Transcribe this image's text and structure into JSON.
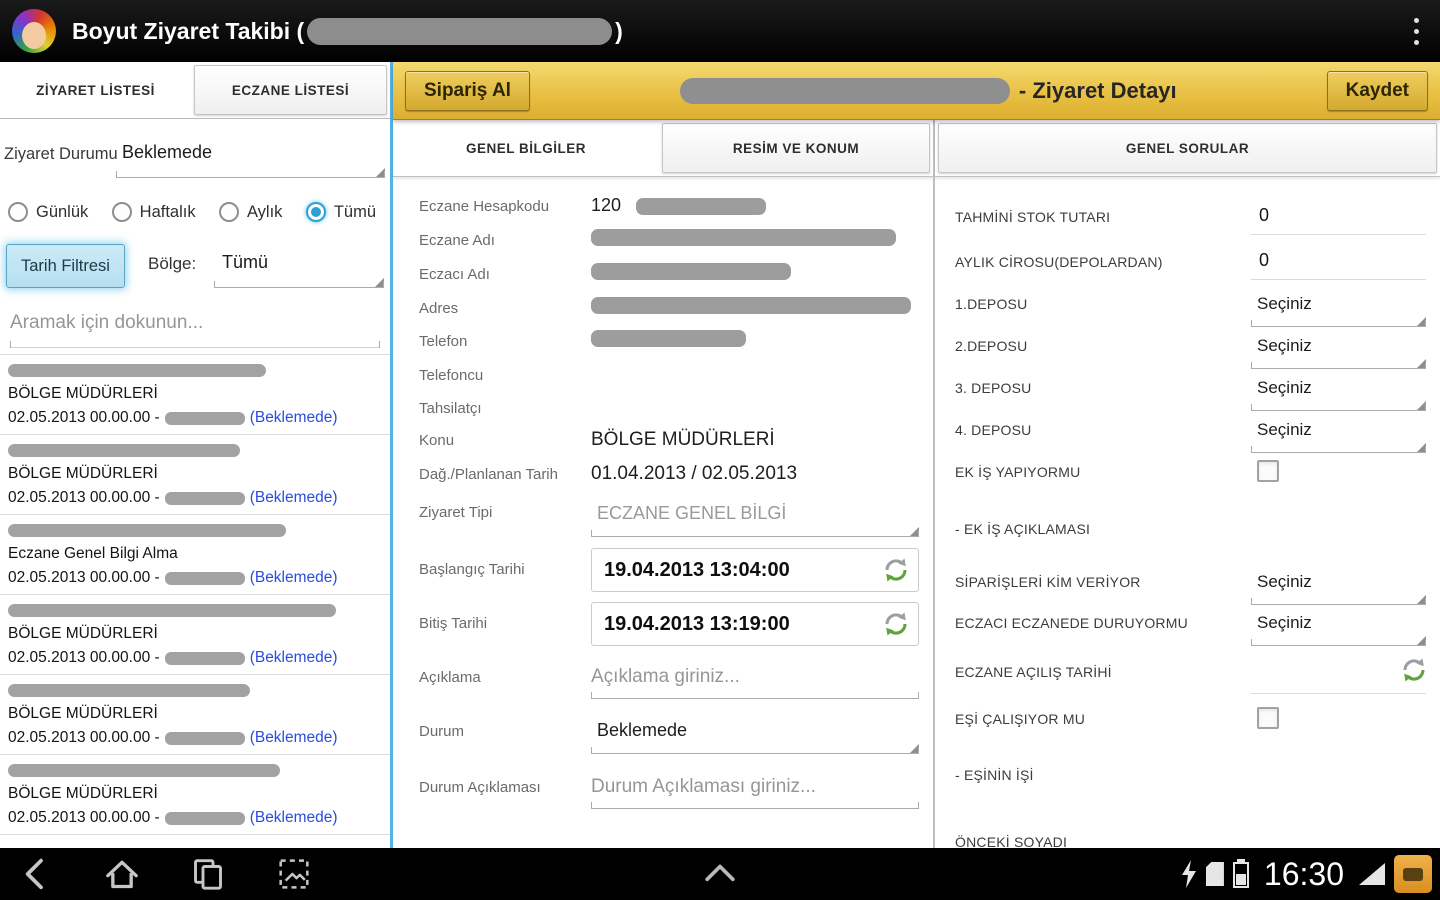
{
  "icons": {
    "overflow": "vertical-ellipsis",
    "refresh_time": "circular-refresh-arrows",
    "spinner_corner": "corner-triangle",
    "back": "back-arrow",
    "home": "home",
    "recents": "recent-apps",
    "screenshot": "screenshot",
    "expand": "chevron-up",
    "charging": "lightning",
    "storage": "sd-card",
    "battery": "battery",
    "signal": "signal-triangle"
  },
  "colors": {
    "accent_blue": "#33B5E5",
    "link_blue": "#2B4BE0",
    "gold_header": "#E7BF41",
    "action_bar": "#000000",
    "redaction": "#9D9D9D",
    "status_orange": "#E09A2F"
  },
  "action_bar": {
    "title_prefix": "Boyut Ziyaret Takibi (",
    "title_suffix": ")"
  },
  "left_panel": {
    "tabs": [
      {
        "label": "ZİYARET LİSTESİ",
        "selected": true
      },
      {
        "label": "ECZANE LİSTESİ",
        "selected": false
      }
    ],
    "filters": {
      "durum_label": "Ziyaret Durumu",
      "durum_value": "Beklemede",
      "radios": [
        {
          "label": "Günlük",
          "selected": false
        },
        {
          "label": "Haftalık",
          "selected": false
        },
        {
          "label": "Aylık",
          "selected": false
        },
        {
          "label": "Tümü",
          "selected": true
        }
      ],
      "tarih_filtresi_button": "Tarih Filtresi",
      "bolge_label": "Bölge:",
      "bolge_value": "Tümü",
      "search_placeholder": "Aramak için dokunun..."
    },
    "visits": [
      {
        "subject": "BÖLGE MÜDÜRLERİ",
        "date": "02.05.2013 00.00.00 -",
        "status": "(Beklemede)"
      },
      {
        "subject": "BÖLGE MÜDÜRLERİ",
        "date": "02.05.2013 00.00.00 -",
        "status": "(Beklemede)"
      },
      {
        "subject": "Eczane Genel Bilgi Alma",
        "date": "02.05.2013 00.00.00 -",
        "status": "(Beklemede)"
      },
      {
        "subject": "BÖLGE MÜDÜRLERİ",
        "date": "02.05.2013 00.00.00 -",
        "status": "(Beklemede)"
      },
      {
        "subject": "BÖLGE MÜDÜRLERİ",
        "date": "02.05.2013 00.00.00 -",
        "status": "(Beklemede)"
      },
      {
        "subject": "BÖLGE MÜDÜRLERİ",
        "date": "02.05.2013 00.00.00 -",
        "status": "(Beklemede)"
      }
    ]
  },
  "detail": {
    "header": {
      "siparis_al": "Sipariş Al",
      "title_suffix": "- Ziyaret Detayı",
      "kaydet": "Kaydet"
    },
    "tabs": [
      {
        "label": "GENEL BİLGİLER",
        "selected": true
      },
      {
        "label": "RESİM VE KONUM",
        "selected": false
      }
    ],
    "form": {
      "eczane_hesapkodu_label": "Eczane Hesapkodu",
      "eczane_hesapkodu_value": "120",
      "eczane_adi_label": "Eczane Adı",
      "eczaci_adi_label": "Eczacı Adı",
      "adres_label": "Adres",
      "telefon_label": "Telefon",
      "telefoncu_label": "Telefoncu",
      "tahsilatci_label": "Tahsilatçı",
      "konu_label": "Konu",
      "konu_value": "BÖLGE MÜDÜRLERİ",
      "planlanan_label": "Dağ./Planlanan Tarih",
      "planlanan_value": "01.04.2013 / 02.05.2013",
      "ziyaret_tipi_label": "Ziyaret Tipi",
      "ziyaret_tipi_value": "ECZANE GENEL BİLGİ",
      "baslangic_label": "Başlangıç Tarihi",
      "baslangic_value": "19.04.2013 13:04:00",
      "bitis_label": "Bitiş Tarihi",
      "bitis_value": "19.04.2013 13:19:00",
      "aciklama_label": "Açıklama",
      "aciklama_placeholder": "Açıklama giriniz...",
      "durum_label": "Durum",
      "durum_value": "Beklemede",
      "durum_aciklamasi_label": "Durum Açıklaması",
      "durum_aciklamasi_placeholder": "Durum Açıklaması giriniz..."
    }
  },
  "sorular": {
    "tab_label": "GENEL SORULAR",
    "stok_label": "TAHMİNİ STOK TUTARI",
    "stok_value": "0",
    "ciro_label": "AYLIK CİROSU(DEPOLARDAN)",
    "ciro_value": "0",
    "depo1_label": "1.DEPOSU",
    "depo1_value": "Seçiniz",
    "depo2_label": "2.DEPOSU",
    "depo2_value": "Seçiniz",
    "depo3_label": "3. DEPOSU",
    "depo3_value": "Seçiniz",
    "depo4_label": "4. DEPOSU",
    "depo4_value": "Seçiniz",
    "ekis_label": "EK İŞ YAPIYORMU",
    "ekis_checked": false,
    "ekis_aciklama_label": "-  EK İŞ AÇIKLAMASI",
    "siparis_kim_label": "SİPARİŞLERİ KİM VERİYOR",
    "siparis_kim_value": "Seçiniz",
    "eczaci_duruyor_label": "ECZACI ECZANEDE DURUYORMU",
    "eczaci_duruyor_value": "Seçiniz",
    "acilis_label": "ECZANE AÇILIŞ TARİHİ",
    "esi_calisiyor_label": "EŞİ ÇALIŞIYOR MU",
    "esi_calisiyor_checked": false,
    "esinin_isi_label": "-  EŞİNİN İŞİ",
    "onceki_soyadi_label": "ÖNCEKİ SOYADI"
  },
  "nav_bar": {
    "time": "16:30"
  }
}
